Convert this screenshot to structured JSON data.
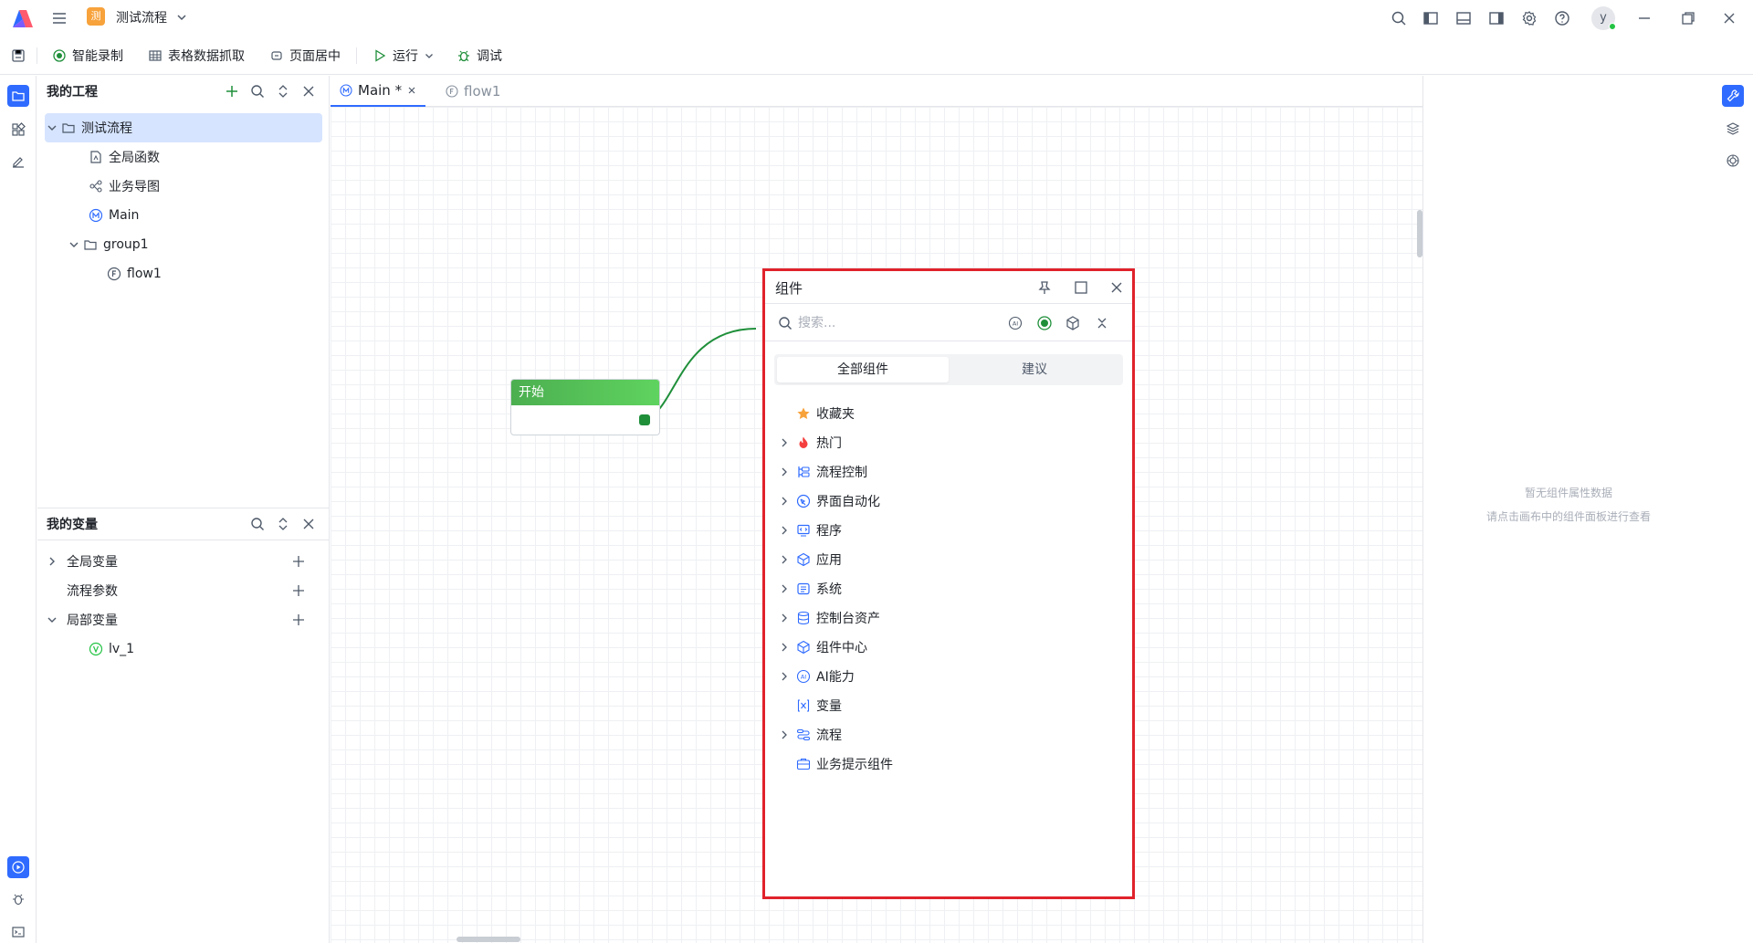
{
  "window": {
    "app_badge": "测",
    "title": "测试流程",
    "avatar_letter": "y"
  },
  "toolbar": {
    "smart_record": "智能录制",
    "table_capture": "表格数据抓取",
    "page_center": "页面居中",
    "run": "运行",
    "debug": "调试"
  },
  "project": {
    "title": "我的工程",
    "tree": [
      {
        "label": "测试流程",
        "kind": "folder",
        "expanded": true,
        "selected": true
      },
      {
        "label": "全局函数",
        "kind": "function-file"
      },
      {
        "label": "业务导图",
        "kind": "mindmap"
      },
      {
        "label": "Main",
        "kind": "main-flow"
      },
      {
        "label": "group1",
        "kind": "folder",
        "expanded": true
      },
      {
        "label": "flow1",
        "kind": "flow"
      }
    ]
  },
  "variables": {
    "title": "我的变量",
    "items": [
      {
        "label": "全局变量",
        "expandable": true
      },
      {
        "label": "流程参数",
        "expandable": false
      },
      {
        "label": "局部变量",
        "expandable": true,
        "expanded": true
      },
      {
        "label": "lv_1",
        "kind": "variable"
      }
    ]
  },
  "tabs": [
    {
      "icon": "M",
      "label": "Main *",
      "active": true
    },
    {
      "icon": "F",
      "label": "flow1",
      "active": false
    }
  ],
  "canvas": {
    "start_node_label": "开始"
  },
  "components": {
    "title": "组件",
    "search_placeholder": "搜索...",
    "segments": [
      "全部组件",
      "建议"
    ],
    "active_segment": 0,
    "categories": [
      {
        "label": "收藏夹",
        "icon": "star-icon",
        "expandable": false,
        "color": "#f7a23b"
      },
      {
        "label": "热门",
        "icon": "flame-icon",
        "expandable": true,
        "color": "#f53f3f"
      },
      {
        "label": "流程控制",
        "icon": "flow-control-icon",
        "expandable": true
      },
      {
        "label": "界面自动化",
        "icon": "ui-automation-icon",
        "expandable": true
      },
      {
        "label": "程序",
        "icon": "program-icon",
        "expandable": true
      },
      {
        "label": "应用",
        "icon": "application-icon",
        "expandable": true
      },
      {
        "label": "系统",
        "icon": "system-icon",
        "expandable": true
      },
      {
        "label": "控制台资产",
        "icon": "database-icon",
        "expandable": true
      },
      {
        "label": "组件中心",
        "icon": "component-center-icon",
        "expandable": true
      },
      {
        "label": "AI能力",
        "icon": "ai-icon",
        "expandable": true
      },
      {
        "label": "变量",
        "icon": "variable-icon",
        "expandable": false
      },
      {
        "label": "流程",
        "icon": "process-icon",
        "expandable": true
      },
      {
        "label": "业务提示组件",
        "icon": "business-tip-icon",
        "expandable": false
      }
    ]
  },
  "properties": {
    "empty_line1": "暂无组件属性数据",
    "empty_line2": "请点击画布中的组件面板进行查看"
  },
  "colors": {
    "accent": "#2f6bff",
    "start_node": "#4caf50",
    "highlight_border": "#e0222b"
  }
}
